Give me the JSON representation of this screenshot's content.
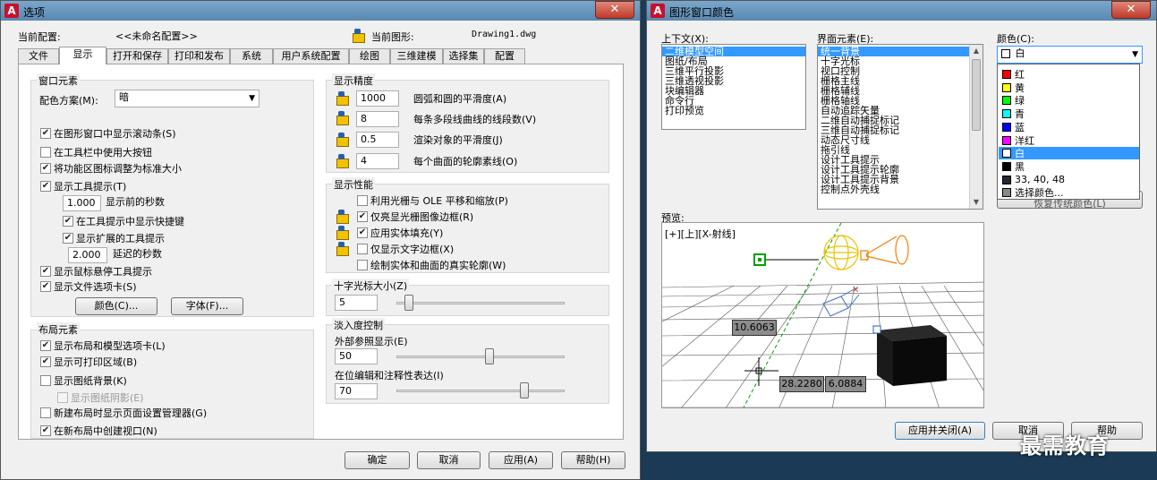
{
  "options_dialog": {
    "title": "选项",
    "current_profile_label": "当前配置:",
    "current_profile_value": "<<未命名配置>>",
    "current_drawing_label": "当前图形:",
    "current_drawing_value": "Drawing1.dwg",
    "tabs": [
      "文件",
      "显示",
      "打开和保存",
      "打印和发布",
      "系统",
      "用户系统配置",
      "绘图",
      "三维建模",
      "选择集",
      "配置"
    ],
    "window_elements": {
      "title": "窗口元素",
      "color_scheme_label": "配色方案(M):",
      "color_scheme_value": "暗",
      "show_scrollbars": "在图形窗口中显示滚动条(S)",
      "large_buttons": "在工具栏中使用大按钮",
      "resize_ribbon_icons": "将功能区图标调整为标准大小",
      "show_tooltips": "显示工具提示(T)",
      "seconds_before_value": "1.000",
      "seconds_before_label": "显示前的秒数",
      "show_shortcut_keys": "在工具提示中显示快捷键",
      "show_extended_tooltips": "显示扩展的工具提示",
      "delay_value": "2.000",
      "delay_label": "延迟的秒数",
      "show_rollover_tooltips": "显示鼠标悬停工具提示",
      "show_file_tabs": "显示文件选项卡(S)",
      "colors_button": "颜色(C)...",
      "fonts_button": "字体(F)..."
    },
    "layout_elements": {
      "title": "布局元素",
      "show_layout_tabs": "显示布局和模型选项卡(L)",
      "show_printable_area": "显示可打印区域(B)",
      "show_paper_background": "显示图纸背景(K)",
      "show_paper_shadow": "显示图纸阴影(E)",
      "show_page_setup_manager": "新建布局时显示页面设置管理器(G)",
      "create_viewport": "在新布局中创建视口(N)"
    },
    "display_resolution": {
      "title": "显示精度",
      "arc_value": "1000",
      "arc_label": "圆弧和圆的平滑度(A)",
      "polyline_value": "8",
      "polyline_label": "每条多段线曲线的线段数(V)",
      "render_value": "0.5",
      "render_label": "渲染对象的平滑度(J)",
      "contour_value": "4",
      "contour_label": "每个曲面的轮廓素线(O)"
    },
    "display_performance": {
      "title": "显示性能",
      "raster_ole": "利用光栅与 OLE 平移和缩放(P)",
      "highlight_raster": "仅亮显光栅图像边框(R)",
      "solid_fill": "应用实体填充(Y)",
      "text_frame": "仅显示文字边框(X)",
      "true_silhouettes": "绘制实体和曲面的真实轮廓(W)"
    },
    "crosshair": {
      "title": "十字光标大小(Z)",
      "value": "5",
      "level": 5
    },
    "fade_control": {
      "title": "淡入度控制",
      "xref_label": "外部参照显示(E)",
      "xref_value": "50",
      "xref_level": 50,
      "inplace_label": "在位编辑和注释性表达(I)",
      "inplace_value": "70",
      "inplace_level": 70
    },
    "buttons": {
      "ok": "确定",
      "cancel": "取消",
      "apply": "应用(A)",
      "help": "帮助(H)"
    }
  },
  "color_dialog": {
    "title": "图形窗口颜色",
    "context_label": "上下文(X):",
    "context_items": [
      "二维模型空间",
      "图纸/布局",
      "三维平行投影",
      "三维透视投影",
      "块编辑器",
      "命令行",
      "打印预览"
    ],
    "interface_label": "界面元素(E):",
    "interface_items": [
      "统一背景",
      "十字光标",
      "视口控制",
      "栅格主线",
      "栅格辅线",
      "栅格轴线",
      "自动追踪矢量",
      "二维自动捕捉标记",
      "三维自动捕捉标记",
      "动态尺寸线",
      "拖引线",
      "设计工具提示",
      "设计工具提示轮廓",
      "设计工具提示背景",
      "控制点外壳线"
    ],
    "color_label": "颜色(C):",
    "color_selected": "白",
    "color_options": [
      {
        "name": "红",
        "hex": "#ff0000"
      },
      {
        "name": "黄",
        "hex": "#ffff00"
      },
      {
        "name": "绿",
        "hex": "#00ff00"
      },
      {
        "name": "青",
        "hex": "#00ffff"
      },
      {
        "name": "蓝",
        "hex": "#0000ff"
      },
      {
        "name": "洋红",
        "hex": "#ff00ff"
      },
      {
        "name": "白",
        "hex": "#ffffff"
      },
      {
        "name": "黑",
        "hex": "#000000"
      },
      {
        "name": "33, 40, 48",
        "hex": "#212830"
      },
      {
        "name": "选择颜色...",
        "hex": "#888888"
      }
    ],
    "restore_button_partial": "恢复传统颜色(L)",
    "preview_label": "预览:",
    "viewport_label": "[+][上][X-射线]",
    "dim_1": "10.6063",
    "dim_2": "28.2280",
    "dim_3": "6.0884",
    "buttons": {
      "apply_close": "应用并关闭(A)",
      "cancel": "取消",
      "help": "帮助"
    }
  },
  "watermark": "最需教育"
}
